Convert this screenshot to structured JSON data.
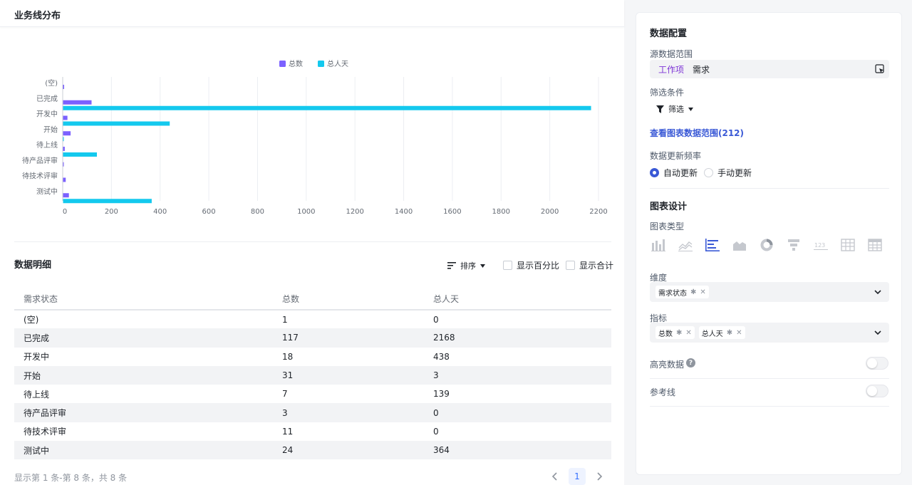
{
  "left": {
    "title": "业务线分布",
    "detail_title": "数据明细",
    "sort_label": "排序",
    "show_percent_label": "显示百分比",
    "show_total_label": "显示合计",
    "table": {
      "headers": [
        "需求状态",
        "总数",
        "总人天"
      ],
      "rows": [
        [
          "(空)",
          "1",
          "0"
        ],
        [
          "已完成",
          "117",
          "2168"
        ],
        [
          "开发中",
          "18",
          "438"
        ],
        [
          "开始",
          "31",
          "3"
        ],
        [
          "待上线",
          "7",
          "139"
        ],
        [
          "待产品评审",
          "3",
          "0"
        ],
        [
          "待技术评审",
          "11",
          "0"
        ],
        [
          "测试中",
          "24",
          "364"
        ]
      ]
    },
    "footer": "显示第 1 条-第 8 条，共 8 条",
    "current_page": "1"
  },
  "chart_data": {
    "type": "bar",
    "orientation": "horizontal",
    "categories": [
      "(空)",
      "已完成",
      "开发中",
      "开始",
      "待上线",
      "待产品评审",
      "待技术评审",
      "测试中"
    ],
    "series": [
      {
        "name": "总数",
        "values": [
          1,
          117,
          18,
          31,
          7,
          3,
          11,
          24
        ],
        "color": "#7b61ff"
      },
      {
        "name": "总人天",
        "values": [
          0,
          2168,
          438,
          3,
          139,
          0,
          0,
          364
        ],
        "color": "#14c9ee"
      }
    ],
    "x_ticks": [
      0,
      200,
      400,
      600,
      800,
      1000,
      1200,
      1400,
      1600,
      1800,
      2000,
      2200
    ],
    "xlim": [
      0,
      2200
    ],
    "grid": true,
    "legend_position": "top-center"
  },
  "right": {
    "data_config_title": "数据配置",
    "source_label": "源数据范围",
    "source_tag": "工作项",
    "source_value": "需求",
    "filter_label": "筛选条件",
    "filter_button": "筛选",
    "view_range_link": "查看图表数据范围(212)",
    "update_freq_label": "数据更新频率",
    "auto_update": "自动更新",
    "manual_update": "手动更新",
    "chart_design_title": "图表设计",
    "chart_type_label": "图表类型",
    "dimension_label": "维度",
    "dimension_chip": "需求状态",
    "metric_label": "指标",
    "metric_chips": [
      "总数",
      "总人天"
    ],
    "highlight_label": "高亮数据",
    "reference_label": "参考线",
    "colors": {
      "accent": "#3a59d6",
      "tag": "#7e35d6"
    }
  }
}
